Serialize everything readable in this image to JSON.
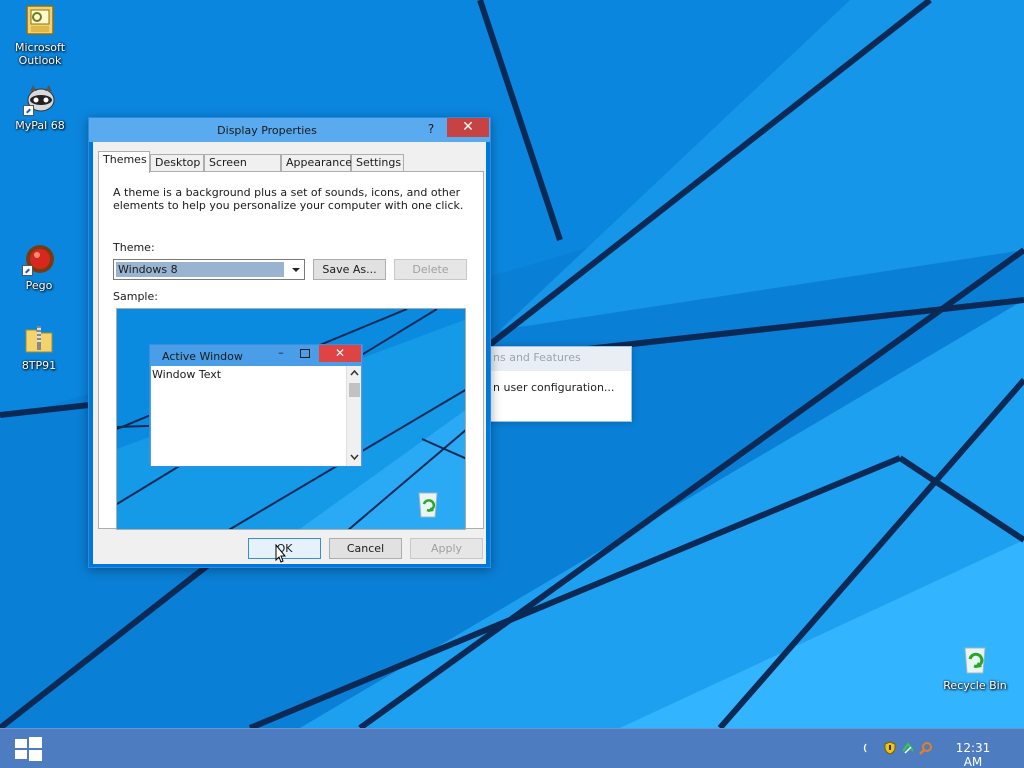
{
  "desktop": {
    "icons": [
      {
        "label": "Microsoft Outlook",
        "icon": "outlook-icon"
      },
      {
        "label": "MyPal 68",
        "icon": "mypal-icon"
      },
      {
        "label": "Pego",
        "icon": "pego-icon"
      },
      {
        "label": "8TP91",
        "icon": "zip-folder-icon"
      },
      {
        "label": "Recycle Bin",
        "icon": "recycle-bin-icon"
      }
    ],
    "wallpaper_color": "#0a7fd6"
  },
  "background_window": {
    "title_fragment": "ns and Features",
    "body_fragment": "n user configuration..."
  },
  "dialog": {
    "title": "Display Properties",
    "help_label": "?",
    "close_label": "✕",
    "tabs": [
      "Themes",
      "Desktop",
      "Screen Saver",
      "Appearance",
      "Settings"
    ],
    "active_tab": "Themes",
    "description": "A theme is a background plus a set of sounds, icons, and other elements to help you personalize your computer with one click.",
    "theme_label": "Theme:",
    "theme_value": "Windows 8",
    "save_as_label": "Save As...",
    "delete_label": "Delete",
    "sample_label": "Sample:",
    "sample": {
      "window_title": "Active Window",
      "window_text": "Window Text",
      "min_label": "–",
      "close_label": "✕"
    },
    "ok_label": "OK",
    "cancel_label": "Cancel",
    "apply_label": "Apply"
  },
  "taskbar": {
    "clock": "12:31 AM",
    "color": "#4d7dc0"
  }
}
